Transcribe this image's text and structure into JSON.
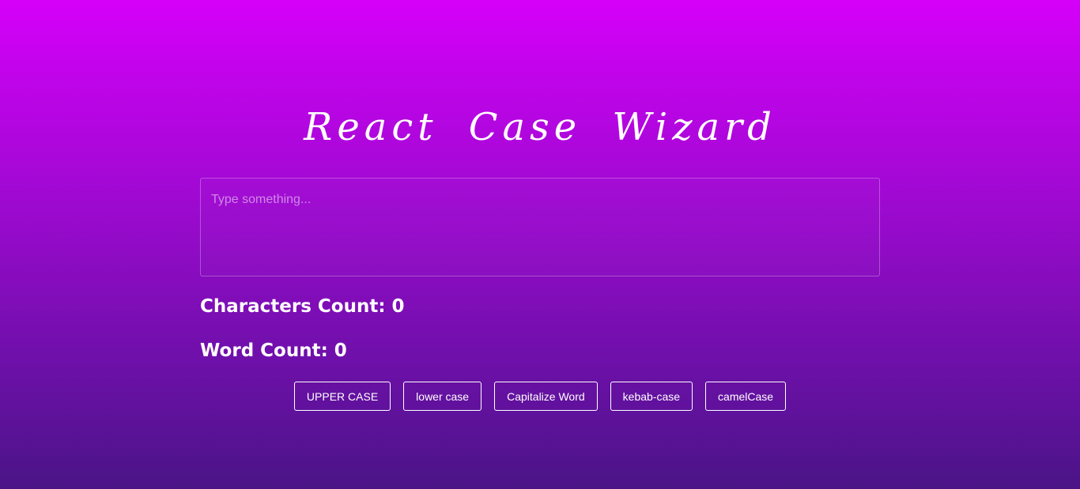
{
  "header": {
    "title": "React Case Wizard"
  },
  "editor": {
    "value": "",
    "placeholder": "Type something..."
  },
  "stats": {
    "characters_label": "Characters Count: 0",
    "words_label": "Word Count: 0"
  },
  "actions": {
    "upper_label": "UPPER CASE",
    "lower_label": "lower case",
    "capitalize_label": "Capitalize Word",
    "kebab_label": "kebab-case",
    "camel_label": "camelCase"
  }
}
